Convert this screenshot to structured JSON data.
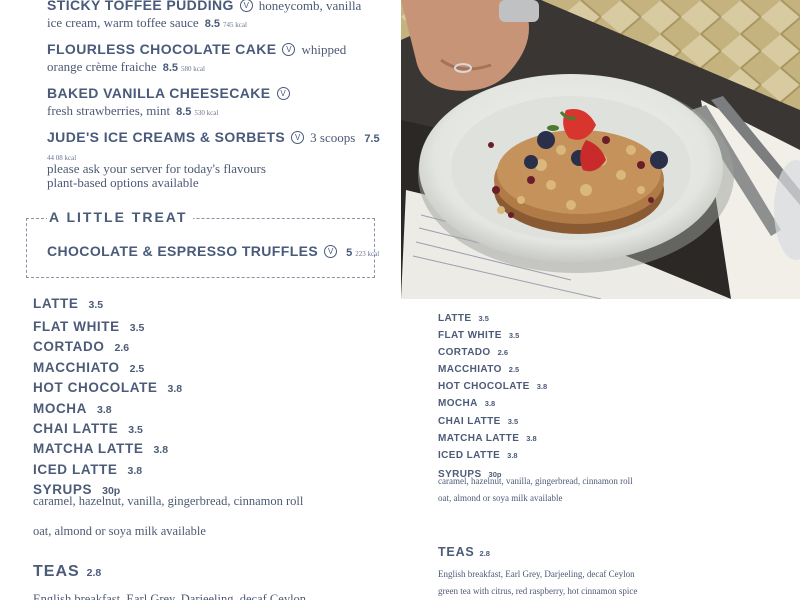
{
  "desserts": [
    {
      "name": "STICKY TOFFEE PUDDING",
      "desc_inline": "honeycomb, vanilla",
      "desc": "ice cream, warm toffee sauce",
      "price": "8.5",
      "kcal": "745 kcal"
    },
    {
      "name": "FLOURLESS CHOCOLATE CAKE",
      "desc_inline": "whipped",
      "desc": "orange crème fraiche",
      "price": "8.5",
      "kcal": "580 kcal"
    },
    {
      "name": "BAKED VANILLA CHEESECAKE",
      "desc_inline": "",
      "desc": "fresh strawberries, mint",
      "price": "8.5",
      "kcal": "530 kcal"
    },
    {
      "name": "JUDE'S ICE CREAMS & SORBETS",
      "desc_inline": "3 scoops",
      "price": "7.5",
      "kcal": "44 08 kcal",
      "desc_line1": "please ask your server for today's flavours",
      "desc_line2": "plant-based options available"
    }
  ],
  "vegan_badge": "V",
  "treat": {
    "title": "A LITTLE TREAT",
    "item": "CHOCOLATE & ESPRESSO TRUFFLES",
    "price": "5",
    "kcal": "223 kcal"
  },
  "photo": {
    "plate_color": "#e9ebe6",
    "background_color": "#c9b78a",
    "table_color": "#2e2c2a"
  },
  "coffee_left": {
    "items": [
      {
        "name": "LATTE",
        "price": "3.5"
      },
      {
        "name": "FLAT WHITE",
        "price": "3.5"
      },
      {
        "name": "CORTADO",
        "price": "2.6"
      },
      {
        "name": "MACCHIATO",
        "price": "2.5"
      },
      {
        "name": "HOT CHOCOLATE",
        "price": "3.8"
      },
      {
        "name": "MOCHA",
        "price": "3.8"
      },
      {
        "name": "CHAI LATTE",
        "price": "3.5"
      },
      {
        "name": "MATCHA LATTE",
        "price": "3.8"
      },
      {
        "name": "ICED LATTE",
        "price": "3.8"
      },
      {
        "name": "SYRUPS",
        "price": "30p"
      }
    ],
    "syrups_desc": "caramel, hazelnut, vanilla, gingerbread, cinnamon roll",
    "milk_note": "oat, almond or soya milk available",
    "teas_title": "TEAS",
    "teas_price": "2.8",
    "teas_desc": "English breakfast, Earl Grey, Darjeeling, decaf Ceylon"
  },
  "coffee_right": {
    "items": [
      {
        "name": "LATTE",
        "price": "3.5"
      },
      {
        "name": "FLAT WHITE",
        "price": "3.5"
      },
      {
        "name": "CORTADO",
        "price": "2.6"
      },
      {
        "name": "MACCHIATO",
        "price": "2.5"
      },
      {
        "name": "HOT CHOCOLATE",
        "price": "3.8"
      },
      {
        "name": "MOCHA",
        "price": "3.8"
      },
      {
        "name": "CHAI LATTE",
        "price": "3.5"
      },
      {
        "name": "MATCHA LATTE",
        "price": "3.8"
      },
      {
        "name": "ICED LATTE",
        "price": "3.8"
      },
      {
        "name": "SYRUPS",
        "price": "30p"
      }
    ],
    "syrups_desc": "caramel, hazelnut, vanilla, gingerbread, cinnamon roll",
    "milk_note": "oat, almond or soya milk available",
    "teas_title": "TEAS",
    "teas_price": "2.8",
    "teas_desc1": "English breakfast, Earl Grey, Darjeeling, decaf Ceylon",
    "teas_desc2": "green tea with citrus, red raspberry, hot cinnamon spice"
  }
}
